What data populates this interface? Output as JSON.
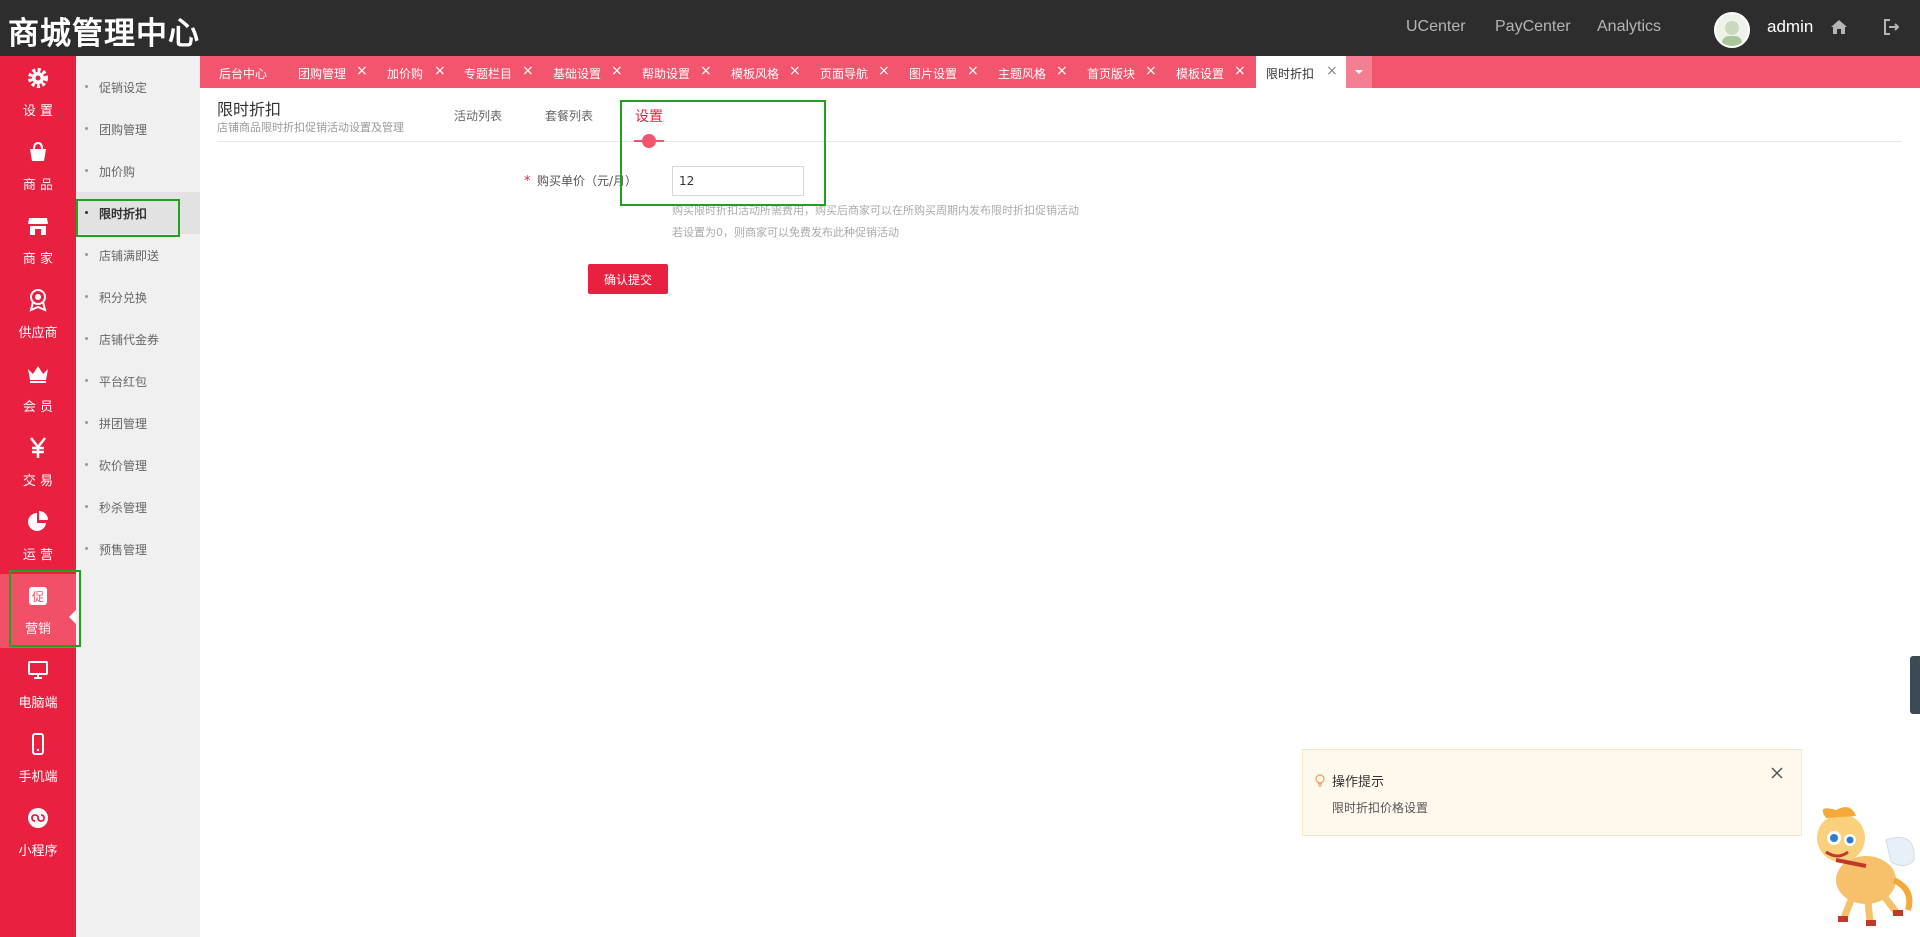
{
  "header": {
    "brand": "商城管理中心",
    "links": [
      "UCenter",
      "PayCenter",
      "Analytics"
    ],
    "username": "admin",
    "icons": [
      "home-icon",
      "logout-icon"
    ]
  },
  "sidebar": {
    "items": [
      {
        "label": "设 置",
        "icon": "gear-icon"
      },
      {
        "label": "商 品",
        "icon": "shopping-bag-icon"
      },
      {
        "label": "商 家",
        "icon": "store-icon"
      },
      {
        "label": "供应商",
        "icon": "award-icon"
      },
      {
        "label": "会 员",
        "icon": "crown-icon"
      },
      {
        "label": "交 易",
        "icon": "yen-icon"
      },
      {
        "label": "运 营",
        "icon": "pie-chart-icon"
      },
      {
        "label": "营销",
        "icon": "promotion-icon",
        "active": true
      },
      {
        "label": "电脑端",
        "icon": "monitor-icon"
      },
      {
        "label": "手机端",
        "icon": "mobile-icon"
      },
      {
        "label": "小程序",
        "icon": "mini-program-icon"
      }
    ]
  },
  "submenu": {
    "items": [
      "促销设定",
      "团购管理",
      "加价购",
      "限时折扣",
      "店铺满即送",
      "积分兑换",
      "店铺代金券",
      "平台红包",
      "拼团管理",
      "砍价管理",
      "秒杀管理",
      "预售管理"
    ],
    "active": "限时折扣"
  },
  "tabs": [
    {
      "label": "后台中心",
      "closable": false
    },
    {
      "label": "团购管理",
      "closable": true
    },
    {
      "label": "加价购",
      "closable": true
    },
    {
      "label": "专题栏目",
      "closable": true
    },
    {
      "label": "基础设置",
      "closable": true
    },
    {
      "label": "帮助设置",
      "closable": true
    },
    {
      "label": "模板风格",
      "closable": true
    },
    {
      "label": "页面导航",
      "closable": true
    },
    {
      "label": "图片设置",
      "closable": true
    },
    {
      "label": "主题风格",
      "closable": true
    },
    {
      "label": "首页版块",
      "closable": true
    },
    {
      "label": "模板设置",
      "closable": true
    },
    {
      "label": "限时折扣",
      "closable": true,
      "current": true
    }
  ],
  "page": {
    "title": "限时折扣",
    "subtitle": "店铺商品限时折扣促销活动设置及管理",
    "subtabs": [
      "活动列表",
      "套餐列表",
      "设置"
    ],
    "active_subtab": "设置"
  },
  "form": {
    "required_mark": "*",
    "price_label": "购买单价（元/月）",
    "price_value": "12",
    "hint_1": "购买限时折扣活动所需费用，购买后商家可以在所购买周期内发布限时折扣促销活动",
    "hint_2": "若设置为0，则商家可以免费发布此种促销活动",
    "submit_label": "确认提交"
  },
  "notice": {
    "title": "操作提示",
    "text": "限时折扣价格设置"
  },
  "colors": {
    "accent": "#e9203f",
    "tab_bar": "#f2556d",
    "topbar": "#2d2d2d",
    "highlight": "#1fa31f"
  }
}
